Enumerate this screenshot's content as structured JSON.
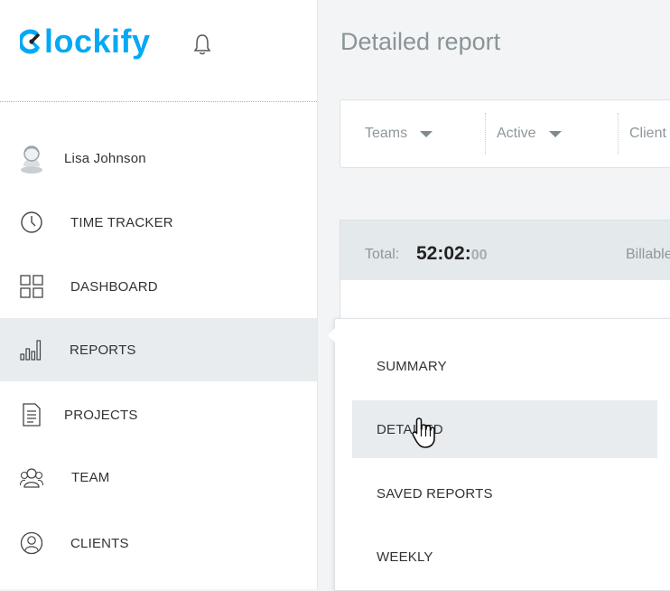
{
  "app": {
    "name": "Clockify"
  },
  "sidebar": {
    "user_name": "Lisa Johnson",
    "items": [
      {
        "label": "TIME TRACKER",
        "icon": "clock-icon"
      },
      {
        "label": "DASHBOARD",
        "icon": "dashboard-grid-icon"
      },
      {
        "label": "REPORTS",
        "icon": "bar-chart-icon",
        "active": true
      },
      {
        "label": "PROJECTS",
        "icon": "document-icon"
      },
      {
        "label": "TEAM",
        "icon": "team-icon"
      },
      {
        "label": "CLIENTS",
        "icon": "client-icon"
      }
    ]
  },
  "header": {
    "title": "Detailed report"
  },
  "filters": [
    {
      "label": "Teams"
    },
    {
      "label": "Active"
    },
    {
      "label": "Client"
    }
  ],
  "totals": {
    "label": "Total:",
    "value_main": "52:02:",
    "value_secs": "00",
    "billable_label": "Billable"
  },
  "reports_menu": {
    "items": [
      {
        "label": "SUMMARY"
      },
      {
        "label": "DETAILED",
        "hovered": true
      },
      {
        "label": "SAVED REPORTS"
      },
      {
        "label": "WEEKLY"
      }
    ]
  },
  "colors": {
    "brand": "#03a9f4",
    "active_bg": "#e8ecef",
    "muted_text": "#8d979c"
  }
}
